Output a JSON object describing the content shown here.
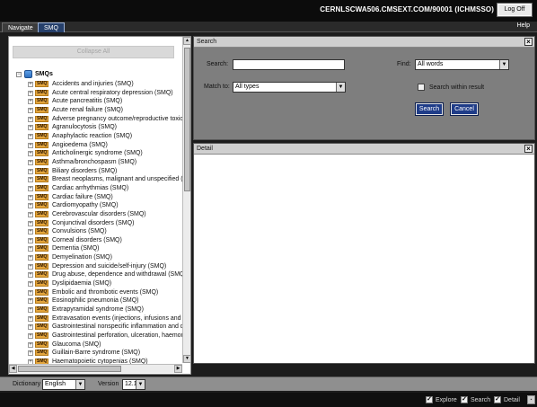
{
  "header": {
    "server": "CERNLSCWA506.CMSEXT.COM/90001 (ICHMSSO)",
    "logoff": "Log Off"
  },
  "tabs": {
    "navigate": "Navigate",
    "smq": "SMQ",
    "help": "Help"
  },
  "tree": {
    "collapse_all": "Collapse All",
    "root_label": "SMQs",
    "tag": "SMQ",
    "items": [
      "Accidents and injuries (SMQ)",
      "Acute central respiratory depression (SMQ)",
      "Acute pancreatitis (SMQ)",
      "Acute renal failure (SMQ)",
      "Adverse pregnancy outcome/reproductive toxicity",
      "Agranulocytosis (SMQ)",
      "Anaphylactic reaction (SMQ)",
      "Angioedema (SMQ)",
      "Anticholinergic syndrome (SMQ)",
      "Asthma/bronchospasm (SMQ)",
      "Biliary disorders (SMQ)",
      "Breast neoplasms, malignant and unspecified (SMQ",
      "Cardiac arrhythmias (SMQ)",
      "Cardiac failure (SMQ)",
      "Cardiomyopathy (SMQ)",
      "Cerebrovascular disorders (SMQ)",
      "Conjunctival disorders (SMQ)",
      "Convulsions (SMQ)",
      "Corneal disorders (SMQ)",
      "Dementia (SMQ)",
      "Demyelination (SMQ)",
      "Depression and suicide/self-injury (SMQ)",
      "Drug abuse, dependence and withdrawal (SMQ)",
      "Dyslipidaemia (SMQ)",
      "Embolic and thrombotic events (SMQ)",
      "Eosinophilic pneumonia (SMQ)",
      "Extrapyramidal syndrome (SMQ)",
      "Extravasation events (injections, infusions and imp",
      "Gastrointestinal nonspecific inflammation and dysfu",
      "Gastrointestinal perforation, ulceration, haemorrha",
      "Glaucoma (SMQ)",
      "Guillain-Barre syndrome (SMQ)",
      "Haematopoietic cytopenias (SMQ)"
    ]
  },
  "search": {
    "title": "Search",
    "search_label": "Search:",
    "search_value": "",
    "find_label": "Find:",
    "find_value": "All words",
    "match_label": "Match to:",
    "match_value": "All types",
    "within_label": "Search within result",
    "search_button": "Search",
    "cancel_button": "Cancel"
  },
  "detail": {
    "title": "Detail"
  },
  "bottom": {
    "dictionary_label": "Dictionary",
    "dictionary_value": "English",
    "version_label": "Version",
    "version_value": "12.1"
  },
  "status": {
    "explore": "Explore",
    "search": "Search",
    "detail": "Detail"
  },
  "icons": {
    "close": "close-icon",
    "dropdown": "chevron-down-icon",
    "tree_expand": "plus-icon",
    "tree_collapse": "minus-icon",
    "root": "folder-icon",
    "check": "check-icon"
  },
  "colors": {
    "primary_button": "#1f3c88",
    "smq_tag": "#e3a53d",
    "active_tab": "#26406b"
  }
}
